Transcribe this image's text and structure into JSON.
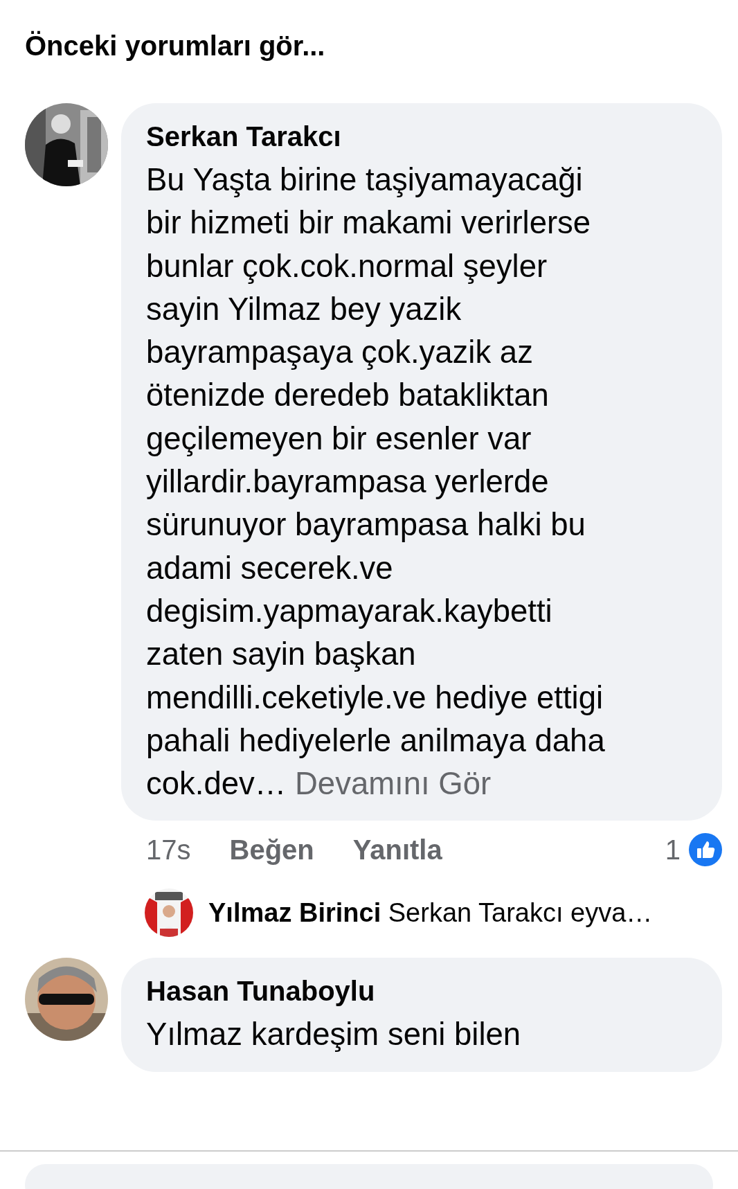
{
  "previous_comments_link": "Önceki yorumları gör...",
  "comments": [
    {
      "author": "Serkan Tarakcı",
      "text": "Bu Yaşta birine taşiyamayacaği\nbir hizmeti bir makami verirlerse\nbunlar çok.cok.normal şeyler\nsayin Yilmaz bey yazik\nbayrampaşaya çok.yazik az\nötenizde deredeb batakliktan\ngeçilemeyen bir esenler var\nyillardir.bayrampasa yerlerde\nsürunuyor bayrampasa halki bu\nadami secerek.ve\ndegisim.yapmayarak.kaybetti\nzaten sayin başkan\nmendilli.ceketiyle.ve hediye ettigi\npahali hediyelerle anilmaya daha\ncok.dev…",
      "see_more": "Devamını Gör",
      "time": "17s",
      "actions": [
        "Beğen",
        "Yanıtla"
      ],
      "like_count": "1",
      "reply": {
        "author": "Yılmaz Birinci",
        "preview": "Serkan Tarakcı eyva…"
      }
    },
    {
      "author": "Hasan Tunaboylu",
      "text": "Yılmaz kardeşim seni bilen"
    }
  ]
}
